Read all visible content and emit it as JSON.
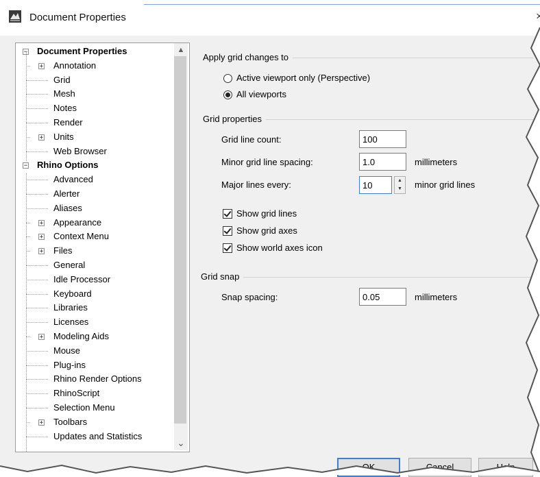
{
  "window": {
    "title": "Document Properties",
    "close_glyph": "×",
    "icon": "rhino-app-icon"
  },
  "tree": {
    "items": [
      {
        "label": "Document Properties",
        "root": true,
        "expander": "⊟"
      },
      {
        "label": "Annotation",
        "expander": "+"
      },
      {
        "label": "Grid"
      },
      {
        "label": "Mesh"
      },
      {
        "label": "Notes"
      },
      {
        "label": "Render"
      },
      {
        "label": "Units",
        "expander": "+"
      },
      {
        "label": "Web Browser"
      },
      {
        "label": "Rhino Options",
        "root": true,
        "expander": "⊟"
      },
      {
        "label": "Advanced"
      },
      {
        "label": "Alerter"
      },
      {
        "label": "Aliases"
      },
      {
        "label": "Appearance",
        "expander": "+"
      },
      {
        "label": "Context Menu",
        "expander": "+"
      },
      {
        "label": "Files",
        "expander": "+"
      },
      {
        "label": "General"
      },
      {
        "label": "Idle Processor"
      },
      {
        "label": "Keyboard"
      },
      {
        "label": "Libraries"
      },
      {
        "label": "Licenses"
      },
      {
        "label": "Modeling Aids",
        "expander": "+"
      },
      {
        "label": "Mouse"
      },
      {
        "label": "Plug-ins"
      },
      {
        "label": "Rhino Render Options"
      },
      {
        "label": "RhinoScript"
      },
      {
        "label": "Selection Menu"
      },
      {
        "label": "Toolbars",
        "expander": "+"
      },
      {
        "label": "Updates and Statistics"
      }
    ],
    "scroll_up": "▲",
    "scroll_down": "⌄"
  },
  "apply_grid": {
    "heading": "Apply grid changes to",
    "options": [
      {
        "label": "Active viewport only (Perspective)",
        "checked": false
      },
      {
        "label": "All viewports",
        "checked": true
      }
    ]
  },
  "grid_properties": {
    "heading": "Grid properties",
    "line_count_label": "Grid line count:",
    "line_count_value": "100",
    "minor_spacing_label": "Minor grid line spacing:",
    "minor_spacing_value": "1.0",
    "minor_spacing_unit": "millimeters",
    "major_every_label": "Major lines every:",
    "major_every_value": "10",
    "major_every_unit": "minor grid lines",
    "spin_up": "▲",
    "spin_down": "▼",
    "show_grid_lines": "Show grid lines",
    "show_grid_axes": "Show grid axes",
    "show_world_axes_icon": "Show world axes icon"
  },
  "grid_snap": {
    "heading": "Grid snap",
    "snap_spacing_label": "Snap spacing:",
    "snap_spacing_value": "0.05",
    "snap_spacing_unit": "millimeters"
  },
  "buttons": {
    "ok": "OK",
    "cancel": "Cancel",
    "help": "Help"
  },
  "colors": {
    "accent": "#3d7fd1",
    "dialog_bg": "#f0f0f0"
  }
}
